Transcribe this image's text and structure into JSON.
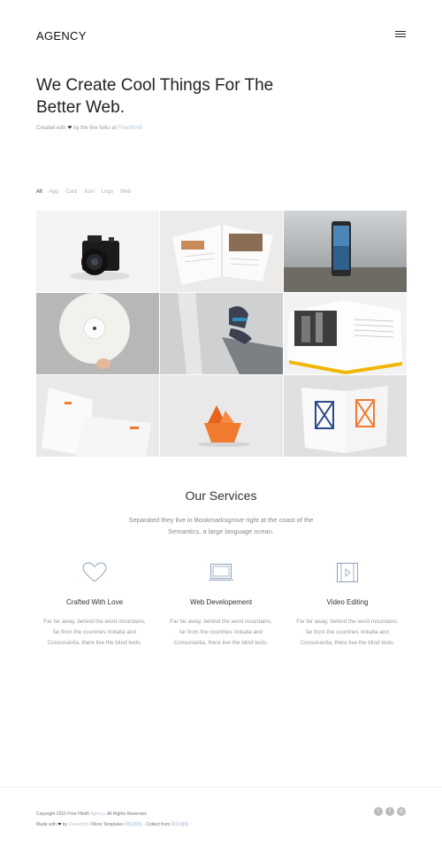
{
  "header": {
    "logo": "AGENCY",
    "menu_icon": "hamburger-icon"
  },
  "hero": {
    "title_line1": "We Create Cool Things For The",
    "title_line2": "Better Web.",
    "sub_prefix": "Created with",
    "sub_mid": "by the fine folks at",
    "sub_link": "FreeHtml5"
  },
  "filters": [
    "All",
    "App",
    "Card",
    "Icon",
    "Logo",
    "Web"
  ],
  "portfolio": [
    {
      "subject": "camera"
    },
    {
      "subject": "open-book"
    },
    {
      "subject": "smartphone"
    },
    {
      "subject": "vinyl-record"
    },
    {
      "subject": "sneakers"
    },
    {
      "subject": "photo-book"
    },
    {
      "subject": "stationery"
    },
    {
      "subject": "paper-boat"
    },
    {
      "subject": "logo-cards"
    }
  ],
  "services": {
    "title": "Our Services",
    "desc_line1": "Separated they live in Bookmarksgrove right at the coast of the",
    "desc_line2": "Semantics, a large language ocean.",
    "items": [
      {
        "icon": "heart-outline-icon",
        "title": "Crafted With Love",
        "l1": "Far far away, behind the word mountains,",
        "l2": "far from the countries Vokalia and",
        "l3": "Consonantia, there live the blind texts."
      },
      {
        "icon": "laptop-outline-icon",
        "title": "Web Developement",
        "l1": "Far far away, behind the word mountains,",
        "l2": "far from the countries Vokalia and",
        "l3": "Consonantia, there live the blind texts."
      },
      {
        "icon": "video-film-icon",
        "title": "Video Editing",
        "l1": "Far far away, behind the word mountains,",
        "l2": "far from the countries Vokalia and",
        "l3": "Consonantia, there live the blind texts."
      }
    ]
  },
  "footer": {
    "copy_prefix": "Copyright 2016 Free Html5",
    "copy_link": "Agency",
    "copy_suffix": "All Rights Reserved.",
    "made_prefix": "Made with",
    "made_by": "by",
    "made_link": "Freehtml5",
    "more_text": "/ More Templates",
    "more_link": "网站模板",
    "collect_text": "- Collect from",
    "collect_link": "网页模板",
    "social": [
      "twitter-icon",
      "facebook-icon",
      "instagram-icon"
    ]
  },
  "colors": {
    "accent_link": "#b3c4d8",
    "orange": "#f07a2e"
  }
}
